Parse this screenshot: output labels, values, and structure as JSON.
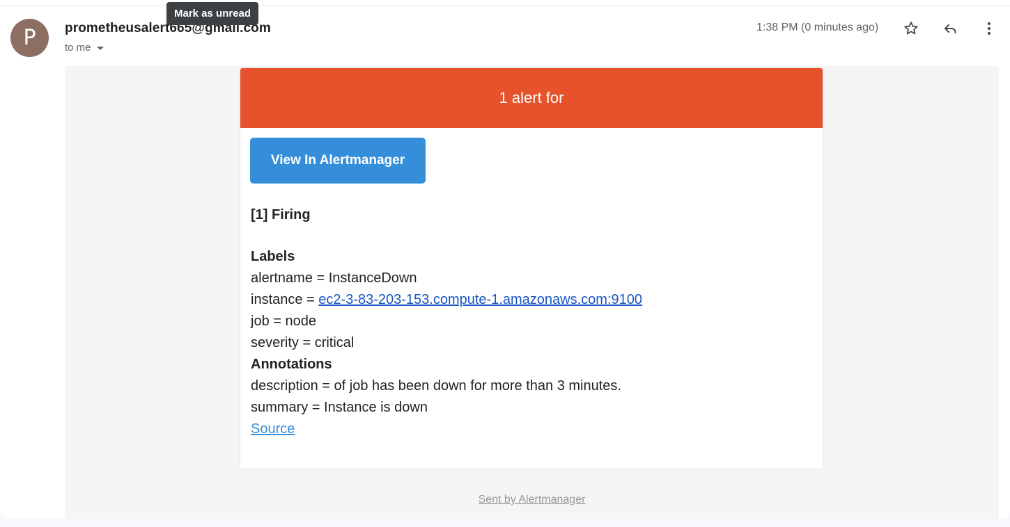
{
  "tooltip": "Mark as unread",
  "header": {
    "avatar_letter": "P",
    "sender": "prometheusalert665@gmail.com",
    "recipient": "to me",
    "time": "1:38 PM (0 minutes ago)",
    "icons": [
      "star-icon",
      "reply-icon",
      "more-vert-icon"
    ]
  },
  "email": {
    "banner": "1 alert for",
    "button": "View In Alertmanager",
    "firing": "[1] Firing",
    "labels_heading": "Labels",
    "alertname": "alertname = InstanceDown",
    "instance_prefix": "instance = ",
    "instance_link": "ec2-3-83-203-153.compute-1.amazonaws.com:9100",
    "job": "job = node",
    "severity": "severity = critical",
    "annotations_heading": "Annotations",
    "description": "description = of job has been down for more than 3 minutes.",
    "summary": "summary = Instance is down",
    "source": "Source",
    "footer": "Sent by Alertmanager"
  },
  "colors": {
    "banner": "#e6522c",
    "button": "#348eda",
    "avatar": "#8d6e63",
    "link": "#1a55c2"
  }
}
